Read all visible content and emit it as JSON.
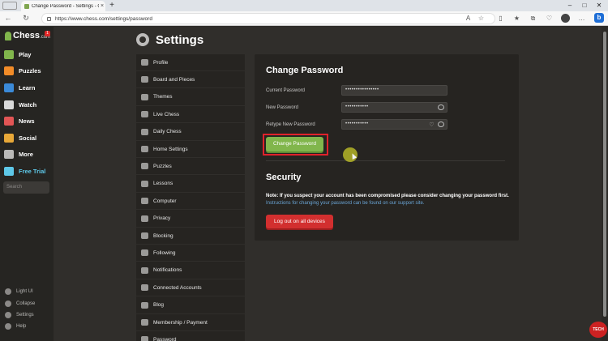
{
  "browser": {
    "tab_title": "Change Password - Settings - Ch",
    "tab_close": "×",
    "new_tab": "+",
    "url": "https://www.chess.com/settings/password",
    "back": "←",
    "refresh": "↻",
    "win_min": "–",
    "win_max": "□",
    "win_close": "✕"
  },
  "leftnav": {
    "logo": "Chess",
    "logo_suffix": ".com",
    "badge": "1",
    "items": [
      {
        "label": "Play",
        "icon": "play-icon",
        "color": "#81b64c"
      },
      {
        "label": "Puzzles",
        "icon": "puzzle-icon",
        "color": "#f28c28"
      },
      {
        "label": "Learn",
        "icon": "learn-icon",
        "color": "#3b8ad8"
      },
      {
        "label": "Watch",
        "icon": "binoculars-icon",
        "color": "#d9d9d9"
      },
      {
        "label": "News",
        "icon": "news-icon",
        "color": "#e25555"
      },
      {
        "label": "Social",
        "icon": "social-icon",
        "color": "#e8a838"
      },
      {
        "label": "More",
        "icon": "more-icon",
        "color": "#bab9b7"
      },
      {
        "label": "Free Trial",
        "icon": "diamond-icon",
        "color": "#5ec8e8"
      }
    ],
    "search_placeholder": "Search",
    "bottom": [
      {
        "label": "Light UI",
        "icon": "sun-icon"
      },
      {
        "label": "Collapse",
        "icon": "collapse-icon"
      },
      {
        "label": "Settings",
        "icon": "gear-icon"
      },
      {
        "label": "Help",
        "icon": "help-icon"
      }
    ]
  },
  "page": {
    "title": "Settings"
  },
  "settings_menu": [
    {
      "label": "Profile",
      "icon": "user-icon"
    },
    {
      "label": "Board and Pieces",
      "icon": "board-icon"
    },
    {
      "label": "Themes",
      "icon": "themes-icon"
    },
    {
      "label": "Live Chess",
      "icon": "clock-icon"
    },
    {
      "label": "Daily Chess",
      "icon": "sun-icon"
    },
    {
      "label": "Home Settings",
      "icon": "home-icon"
    },
    {
      "label": "Puzzles",
      "icon": "puzzle-icon"
    },
    {
      "label": "Lessons",
      "icon": "lessons-icon"
    },
    {
      "label": "Computer",
      "icon": "computer-icon"
    },
    {
      "label": "Privacy",
      "icon": "shield-icon"
    },
    {
      "label": "Blocking",
      "icon": "block-icon"
    },
    {
      "label": "Following",
      "icon": "following-icon"
    },
    {
      "label": "Notifications",
      "icon": "bell-icon"
    },
    {
      "label": "Connected Accounts",
      "icon": "link-icon"
    },
    {
      "label": "Blog",
      "icon": "blog-icon"
    },
    {
      "label": "Membership / Payment",
      "icon": "membership-icon"
    },
    {
      "label": "Password",
      "icon": "lock-icon"
    }
  ],
  "change_password": {
    "heading": "Change Password",
    "current_label": "Current Password",
    "current_value": "••••••••••••••••",
    "new_label": "New Password",
    "new_value": "•••••••••••",
    "retype_label": "Retype New Password",
    "retype_value": "•••••••••••",
    "button": "Change Password"
  },
  "security": {
    "heading": "Security",
    "note_bold": "Note: If you suspect your account has been compromised please consider changing your password first.",
    "note_link": "Instructions for changing your password can be found on our support site.",
    "logout_button": "Log out on all devices"
  }
}
